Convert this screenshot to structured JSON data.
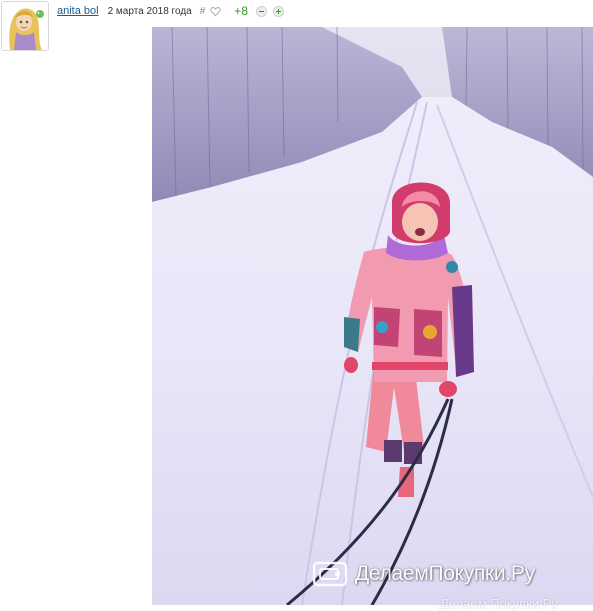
{
  "post": {
    "author": "anita bol",
    "date": "2 марта 2018 года",
    "hash_symbol": "#",
    "rating": "+8"
  },
  "icons": {
    "avatar": "avatar-rapunzel",
    "like": "heart-outline-icon",
    "vote_down": "minus-icon",
    "vote_up": "plus-icon",
    "watermark_logo": "wallet-icon"
  },
  "photo": {
    "watermark": "ДелаемПокупки.Ру",
    "watermark_partial": "Делаем Покупки.Ру"
  },
  "colors": {
    "link": "#1a5c9c",
    "rating": "#2e9a1e",
    "vote_down": "#d03030",
    "vote_up": "#2e9a1e"
  }
}
